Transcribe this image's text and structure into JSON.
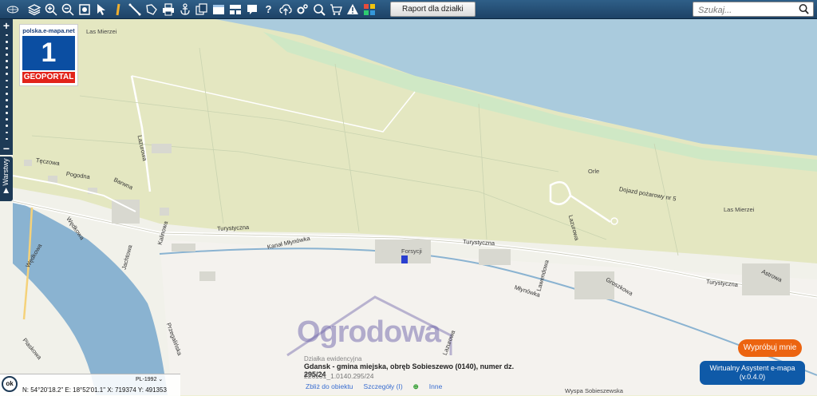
{
  "toolbar": {
    "report_label": "Raport dla działki",
    "search_placeholder": "Szukaj..."
  },
  "zoom": {
    "plus": "+",
    "minus": "−",
    "layers_label": "Warstwy"
  },
  "logo": {
    "site": "polska.e-mapa.net",
    "number": "1",
    "text": "GEOPORTAL"
  },
  "map_labels": {
    "las_mierzei_1": "Las Mierzei",
    "las_mierzei_2": "Las Mierzei",
    "orle": "Orle",
    "dojazd": "Dojazd pożarowy nr 5",
    "teczowa": "Tęczowa",
    "pogodna": "Pogodna",
    "barwna": "Barwna",
    "lazurowa": "Lazurowa",
    "wedkowa": "Wędkowa",
    "turystyczna_1": "Turystyczna",
    "turystyczna_2": "Turystyczna",
    "turystyczna_3": "Turystyczna",
    "forsycji": "Forsycji",
    "kanal_mlynowka": "Kanał Młynówka",
    "mlynowka": "Młynówka",
    "groszkowa": "Groszkowa",
    "astrowa": "Astrowa",
    "wyspa": "Wyspa Sobieszewska",
    "lazurowa_2": "Lazurowa",
    "przegalinska": "Przegalińska",
    "kalinowa": "Kalinowa",
    "jachtowa": "Jachtowa",
    "lawendowa": "Lawendowa",
    "wedkowa_2": "Wędkowa",
    "piaskowa": "Piaskowa",
    "lazurowa_3": "Lazurowa"
  },
  "watermark": {
    "text": "Ogrodowa"
  },
  "parcel": {
    "title": "Działka ewidencyjna",
    "location": "Gdansk - gmina miejska, obręb Sobieszewo (0140), numer dz. 295/24",
    "id": "226101_1.0140.295/24",
    "link_zoom": "Zbliż do obiektu",
    "link_details": "Szczegóły (I)",
    "link_other": "Inne"
  },
  "coords": {
    "ok": "ok",
    "crs": "PL-1992",
    "line": "N: 54°20'18.2\"  E: 18°52'01.1\"  X: 719374    Y: 491353"
  },
  "assistant": {
    "try_label": "Wypróbuj mnie",
    "line1": "Wirtualny Asystent e-mapa",
    "line2": "(v.0.4.0)"
  },
  "colors": {
    "toolbar": "#1d4266",
    "sea": "#aacbdd",
    "forest": "#e4e7c1",
    "beach": "#cfe8c5",
    "water": "#8ab3d1",
    "accent_orange": "#ec6410",
    "assistant_blue": "#0f5aa8"
  }
}
